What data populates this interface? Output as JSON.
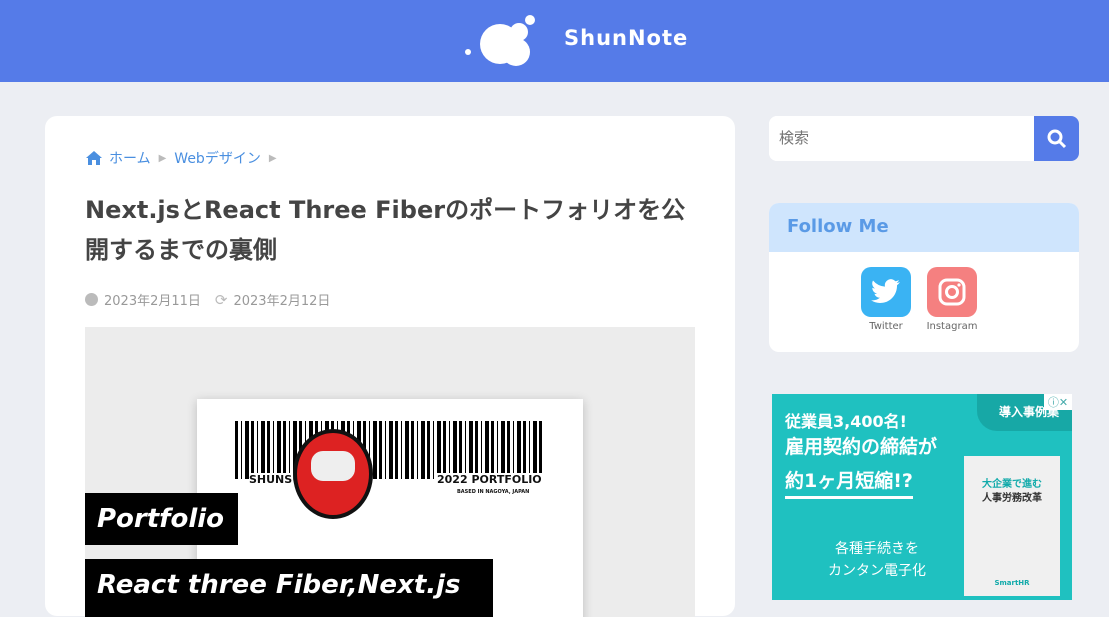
{
  "header": {
    "site_title": "ShunNote"
  },
  "breadcrumb": {
    "home": "ホーム",
    "category": "Webデザイン"
  },
  "article": {
    "title": "Next.jsとReact Three Fiberのポートフォリオを公開するまでの裏側",
    "published": "2023年2月11日",
    "updated": "2023年2月12日",
    "hero": {
      "card_name": "SHUNSUKE ITO",
      "card_year": "2022 PORTFOLIO",
      "card_loc": "BASED IN NAGOYA, JAPAN",
      "tag1": "Portfolio",
      "tag2": "React three Fiber,Next.js"
    }
  },
  "search": {
    "placeholder": "検索"
  },
  "follow": {
    "title": "Follow Me",
    "twitter": "Twitter",
    "instagram": "Instagram"
  },
  "ad": {
    "line1": "従業員3,400名!",
    "line2": "雇用契約の締結が",
    "line3": "約1ヶ月短縮!?",
    "line4a": "各種手続きを",
    "line4b": "カンタン電子化",
    "pill": "導入事例集",
    "book_title1": "大企業で進む",
    "book_title2": "人事労務改革",
    "book_brand": "SmartHR"
  }
}
